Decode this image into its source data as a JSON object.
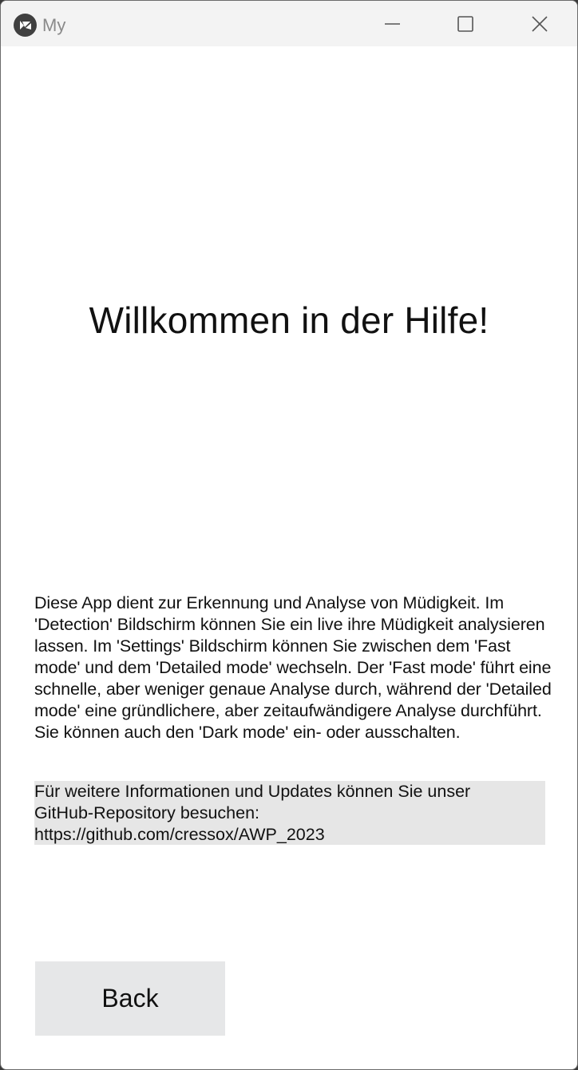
{
  "window": {
    "title": "My",
    "controls": {
      "minimize": "minimize-icon",
      "maximize": "maximize-icon",
      "close": "close-icon"
    }
  },
  "help": {
    "heading": "Willkommen in der Hilfe!",
    "description": "Diese App dient zur Erkennung und Analyse von Müdigkeit. Im 'Detection' Bildschirm können Sie ein live ihre Müdigkeit analysieren lassen. Im 'Settings' Bildschirm können Sie zwischen dem 'Fast mode' und dem 'Detailed mode' wechseln. Der 'Fast mode' führt eine schnelle, aber weniger genaue Analyse durch, während der 'Detailed mode' eine gründlichere, aber zeitaufwändigere Analyse durchführt. Sie können auch den 'Dark mode' ein- oder ausschalten.",
    "info": "Für weitere Informationen und Updates können Sie unser\nGitHub-Repository besuchen:\nhttps://github.com/cressox/AWP_2023",
    "back_label": "Back"
  },
  "colors": {
    "titlebar": "#f3f3f3",
    "background": "#ffffff",
    "info_box": "#e6e6e6",
    "button": "#e6e7e8",
    "text": "#111111"
  }
}
